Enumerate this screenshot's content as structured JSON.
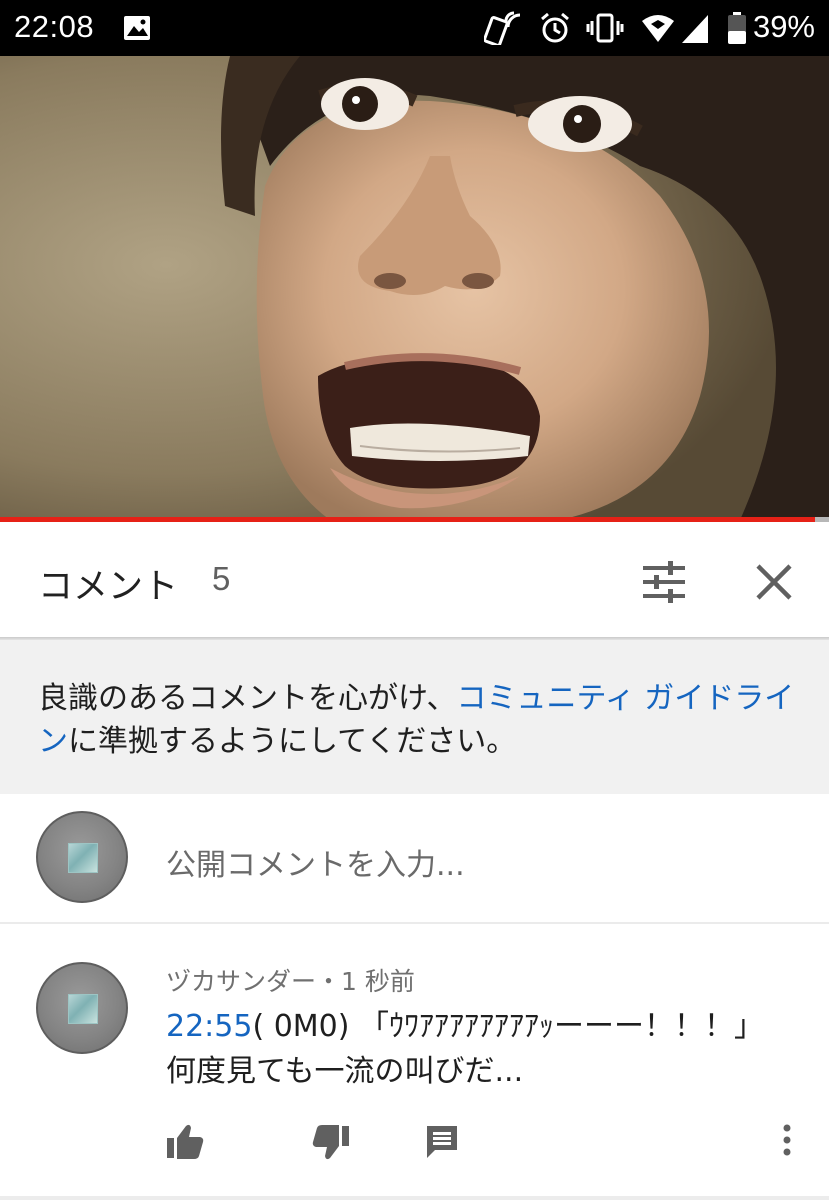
{
  "status_bar": {
    "time": "22:08",
    "battery": "39%",
    "icons": [
      "image-icon",
      "nfc-phone-icon",
      "alarm-icon",
      "vibrate-icon",
      "wifi-icon",
      "cell-signal-icon",
      "battery-icon"
    ]
  },
  "video": {
    "thumbnail": "screaming-face-frame",
    "progress": 0.983,
    "colors": {
      "progress": "#e62117",
      "track": "#b7b7b7"
    }
  },
  "comments_header": {
    "title": "コメント",
    "count": "5",
    "icons": [
      "sort-filter-icon",
      "close-icon"
    ]
  },
  "notice": {
    "text_before": "良識のあるコメントを心がけ、",
    "link": "コミュニティ ガイドライン",
    "text_after": "に準拠するようにしてください。"
  },
  "comment_input": {
    "placeholder": "公開コメントを入力..."
  },
  "comments": [
    {
      "meta": "ヅカサンダー・1 秒前",
      "timestamp": "22:55",
      "text_line1": "( 0M0) 「ｳﾜｱｱｱｱｱｱｱｱｯーーー！！！」",
      "text_line2": "何度見ても一流の叫びだ...",
      "actions": [
        "like-icon",
        "dislike-icon",
        "reply-icon",
        "more-vert-icon"
      ]
    }
  ],
  "colors": {
    "link": "#1565c0",
    "accent_red": "#e62117",
    "notice_bg": "#f1f1f1"
  }
}
